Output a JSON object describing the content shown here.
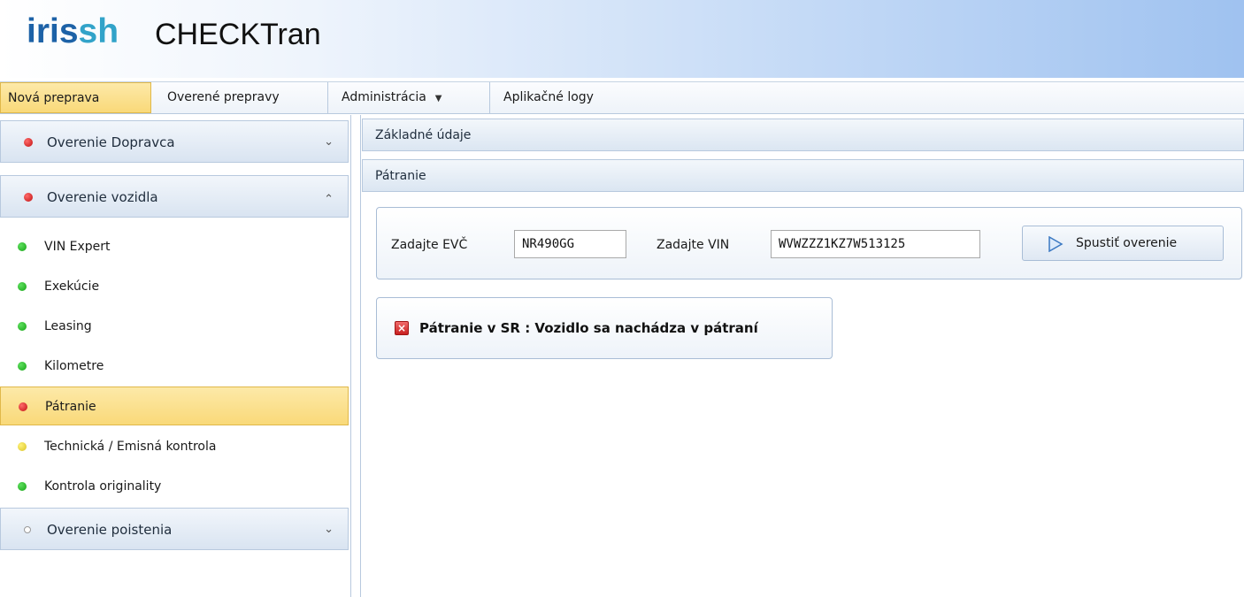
{
  "header": {
    "logo_part1": "iris",
    "logo_part2": "sh",
    "app_name": "CHECKTran"
  },
  "menu": {
    "items": [
      {
        "label": "Nová preprava",
        "active": true
      },
      {
        "label": "Overené prepravy"
      },
      {
        "label": "Administrácia",
        "has_dropdown": true
      },
      {
        "label": "Aplikačné logy"
      }
    ]
  },
  "sidebar": {
    "sections": [
      {
        "label": "Overenie Dopravca",
        "status": "red",
        "expanded": false
      },
      {
        "label": "Overenie vozidla",
        "status": "red",
        "expanded": true
      },
      {
        "label": "Overenie poistenia",
        "status": "none",
        "expanded": false
      }
    ],
    "items": [
      {
        "label": "VIN Expert",
        "status": "green"
      },
      {
        "label": "Exekúcie",
        "status": "green"
      },
      {
        "label": "Leasing",
        "status": "green"
      },
      {
        "label": "Kilometre",
        "status": "green"
      },
      {
        "label": "Pátranie",
        "status": "red",
        "active": true
      },
      {
        "label": "Technická / Emisná kontrola",
        "status": "yellow"
      },
      {
        "label": "Kontrola originality",
        "status": "green"
      }
    ]
  },
  "main": {
    "panels": [
      {
        "label": "Základné údaje"
      },
      {
        "label": "Pátranie"
      }
    ],
    "form": {
      "evc_label": "Zadajte EVČ",
      "evc_value": "NR490GG",
      "vin_label": "Zadajte VIN",
      "vin_value": "WVWZZZ1KZ7W513125",
      "submit_label": "Spustiť overenie"
    },
    "result": {
      "message": "Pátranie v SR : Vozidlo sa nachádza v pátraní",
      "icon": "error-icon"
    }
  },
  "colors": {
    "active_tab": "#f9d979",
    "status_red": "#c01010",
    "status_green": "#14a314",
    "status_yellow": "#d9c324",
    "logo_dark": "#1d62a7",
    "logo_light": "#32a3c9"
  }
}
